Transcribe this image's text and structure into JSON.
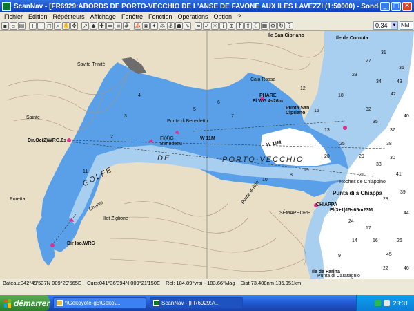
{
  "window": {
    "title": "ScanNav - [FR6929:ABORDS DE PORTO-VECCHIO DE L'ANSE DE FAVONE AUX ILES LAVEZZI (1:50000) - Sondes en  Mètres]",
    "minimize_icon": "minimize-icon",
    "maximize_icon": "maximize-icon",
    "close_icon": "close-icon"
  },
  "menu": [
    "Fichier",
    "Edition",
    "Répétiteurs",
    "Affichage",
    "Fenêtre",
    "Fonction",
    "Opérations",
    "Option",
    "?"
  ],
  "toolbar": {
    "scale_value": "0.34",
    "unit_value": "NM"
  },
  "map": {
    "colors": {
      "land": "#e9dfc6",
      "shallow": "#5aa0e8",
      "mid": "#a9cff0",
      "deep": "#ffffff",
      "contour": "#9b8a6b"
    },
    "labels": {
      "golfe": "GOLFE",
      "de": "DE",
      "porto_vecchio": "PORTO-VECCHIO",
      "ile_san_cipriano": "Ile San Cipriano",
      "ile_de_cornuta": "Ile de Cornuta",
      "phare": "PHARE",
      "phare_light": "Fl WG 4s26m",
      "punta_san_cipriano": "Punta San Cipriano",
      "punta_di_benedettu": "Punta di Benedettu",
      "savite_trinite": "Savite Trinité",
      "dir_light_left": "Dir.Oc(2)WRG.6s",
      "dir_light_bottom": "Dir Iso.WRG",
      "light_benedettu": "Fl(4)G",
      "benedettu": "Benedettu",
      "roches_chiappino": "Roches de Chiappino",
      "punta_chiappa": "Punta di a Chiappa",
      "chiappa": "CHIAPPA",
      "chiappa_light": "Fl(3+1)15s65m23M",
      "semaphore": "SÉMAPHORE",
      "ile_de_farina": "Ile de Farina",
      "punta_di_caratagnio": "Punta di Caratagnio",
      "poretta": "Poretta",
      "cala_rossa": "Cala Rossa",
      "ilot_ziglione": "Ilot Ziglione",
      "chenal": "Chenal",
      "punta_di_arje": "Punta di Arje",
      "sainte_lucie": "Sainte",
      "bearing_left": "W 11M",
      "bearing_right": "W 11M",
      "depths": [
        "42",
        "35",
        "38",
        "41",
        "33",
        "29",
        "25",
        "20",
        "19",
        "12",
        "15",
        "18",
        "23",
        "27",
        "31",
        "36",
        "40",
        "28",
        "17",
        "14",
        "9",
        "7",
        "6",
        "5",
        "4",
        "3",
        "2",
        "11",
        "16",
        "22",
        "26",
        "44",
        "13",
        "8",
        "10",
        "21",
        "24",
        "30",
        "32",
        "34",
        "37",
        "39",
        "43",
        "45",
        "46"
      ]
    }
  },
  "status": {
    "bateau": "Bateau:042°49'537N 009°29'565E",
    "curs": "Curs:041°36'394N 009°21'150E",
    "rel": "Rel: 184.89°vrai - 183.66°Mag",
    "dist": "Dist:73.408nm   135.951km"
  },
  "taskbar": {
    "start_label": "démarrer",
    "tasks": [
      "\\\\Gekoyote-g5\\Geko\\...",
      "ScanNav - [FR6929:A..."
    ],
    "clock": "23:31"
  }
}
